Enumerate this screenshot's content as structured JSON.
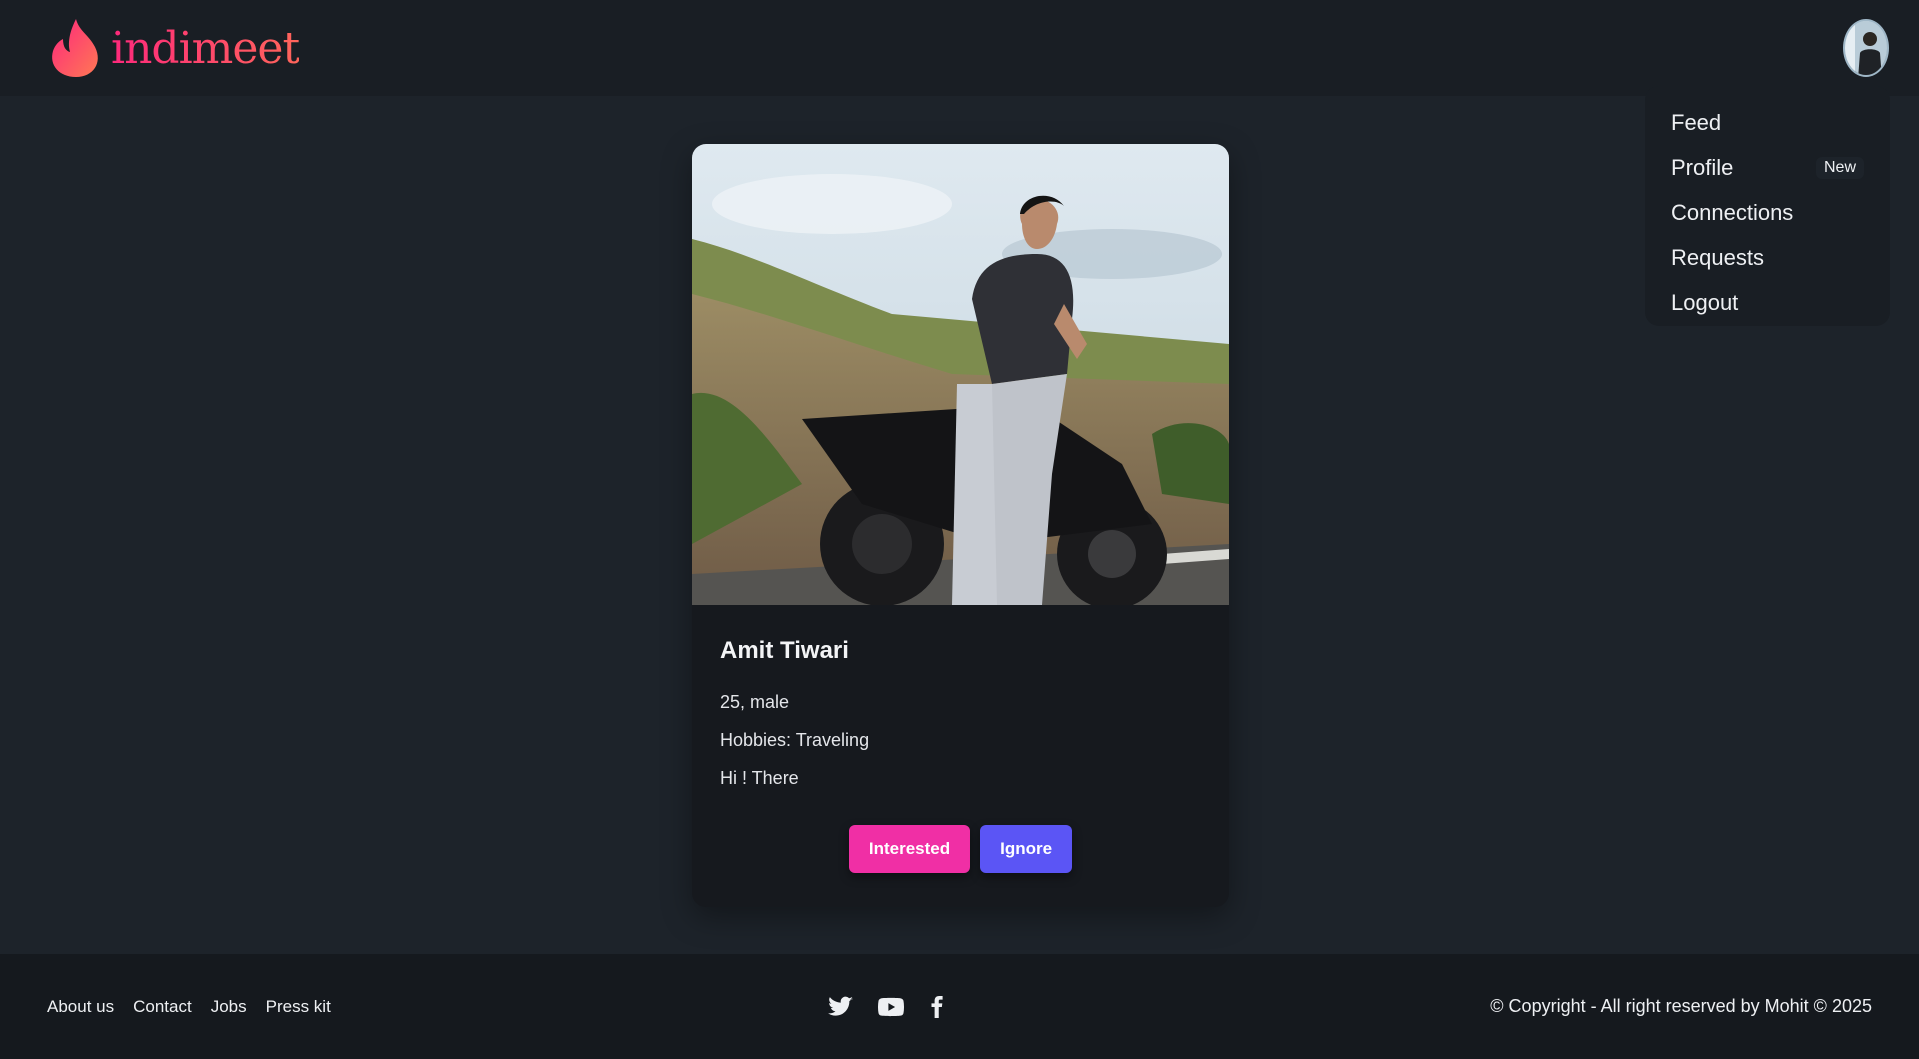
{
  "brand": {
    "name": "indimeet",
    "color": "#fd5270"
  },
  "navbar": {
    "avatar_label": "user avatar"
  },
  "menu": {
    "items": [
      {
        "label": "Feed",
        "badge": ""
      },
      {
        "label": "Profile",
        "badge": "New"
      },
      {
        "label": "Connections",
        "badge": ""
      },
      {
        "label": "Requests",
        "badge": ""
      },
      {
        "label": "Logout",
        "badge": ""
      }
    ]
  },
  "card": {
    "name": "Amit Tiwari",
    "age_gender": "25, male",
    "hobbies": "Hobbies: Traveling",
    "about": "Hi ! There",
    "interested_label": "Interested",
    "ignore_label": "Ignore",
    "interested_color": "#f02fa5",
    "ignore_color": "#5b55f5"
  },
  "footer": {
    "links": [
      "About us",
      "Contact",
      "Jobs",
      "Press kit"
    ],
    "social_icons": [
      "twitter-icon",
      "youtube-icon",
      "facebook-icon"
    ],
    "copyright": "© Copyright - All right reserved by Mohit © 2025"
  }
}
